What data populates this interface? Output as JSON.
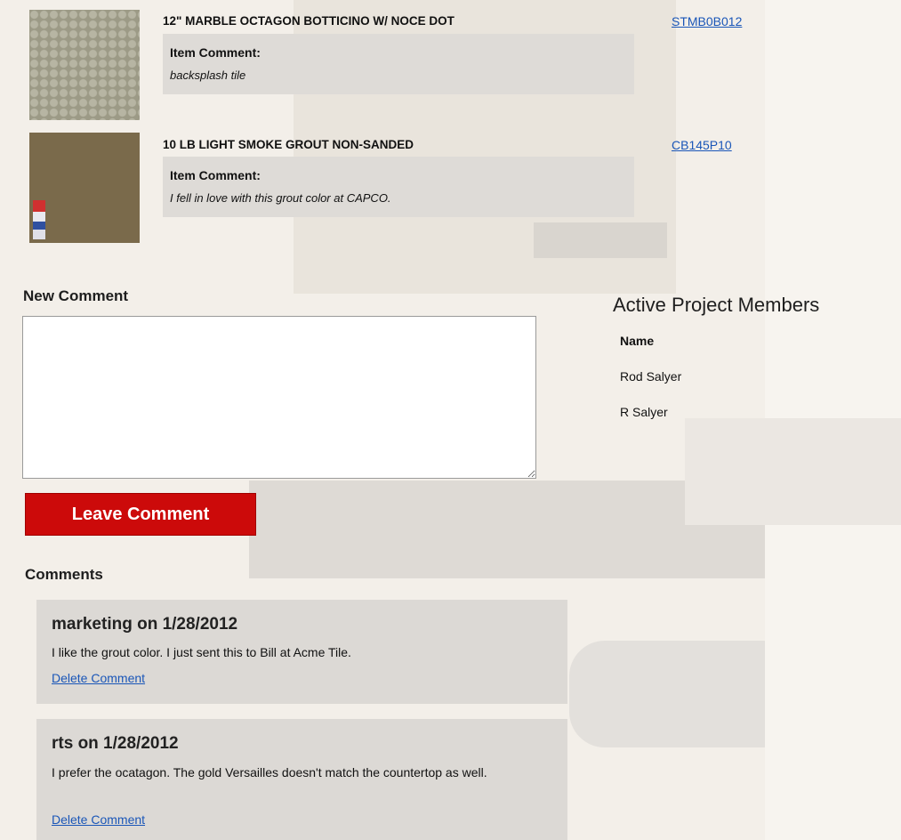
{
  "products": [
    {
      "title": "12\" MARBLE OCTAGON BOTTICINO W/ NOCE DOT",
      "comment_label": "Item Comment:",
      "comment_text": "backsplash tile",
      "sku": "STMB0B012"
    },
    {
      "title": "10 LB LIGHT SMOKE GROUT NON-SANDED",
      "comment_label": "Item Comment:",
      "comment_text": "I fell in love with this grout color at CAPCO.",
      "sku": "CB145P10"
    }
  ],
  "new_comment": {
    "heading": "New Comment",
    "value": "",
    "button_label": "Leave Comment"
  },
  "members": {
    "title": "Active Project Members",
    "column_header": "Name",
    "names": [
      "Rod Salyer",
      "R Salyer"
    ]
  },
  "comments": {
    "heading": "Comments",
    "items": [
      {
        "header": "marketing on 1/28/2012",
        "body": "I like the grout color. I just sent this to Bill at Acme Tile.",
        "delete_label": "Delete Comment"
      },
      {
        "header": "rts on 1/28/2012",
        "body": "I prefer the ocatagon. The gold Versailles doesn't match the countertop as well.",
        "delete_label": "Delete Comment"
      }
    ]
  },
  "colors": {
    "accent_button": "#cc0a0a",
    "link": "#1a56b8",
    "panel": "#dcd9d5"
  }
}
